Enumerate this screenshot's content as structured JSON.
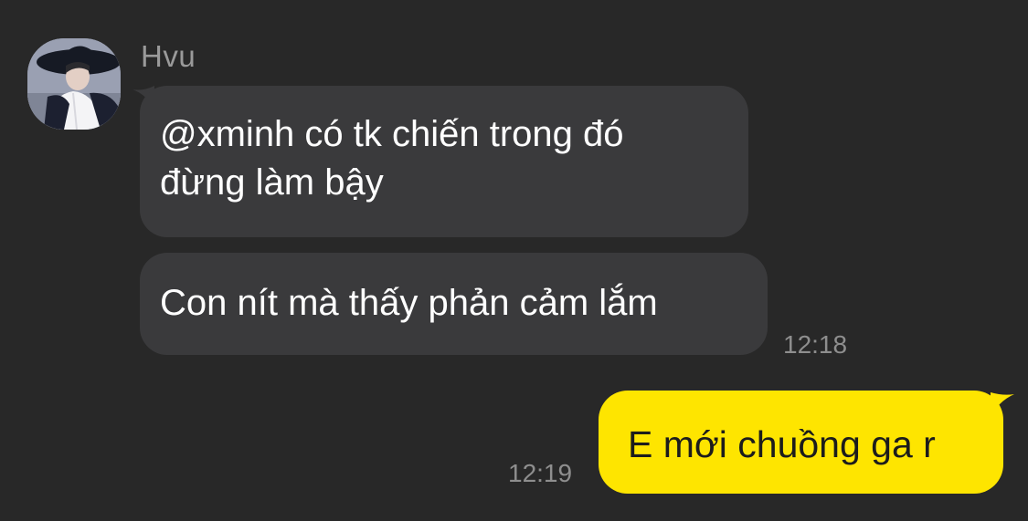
{
  "sender": {
    "name": "Hvu",
    "avatar": "profile-photo"
  },
  "messages": [
    {
      "direction": "incoming",
      "lines": [
        "@xminh có tk chiến trong đó",
        "đừng làm bậy"
      ]
    },
    {
      "direction": "incoming",
      "text": "Con nít mà thấy phản cảm lắm",
      "time": "12:18"
    },
    {
      "direction": "outgoing",
      "text": "E mới chuồng ga r",
      "time": "12:19"
    }
  ],
  "colors": {
    "background": "#282828",
    "incoming_bubble": "#3a3a3c",
    "outgoing_bubble": "#fee500",
    "incoming_text": "#ffffff",
    "outgoing_text": "#1c1c1c",
    "meta_text": "#8e8e8e"
  }
}
